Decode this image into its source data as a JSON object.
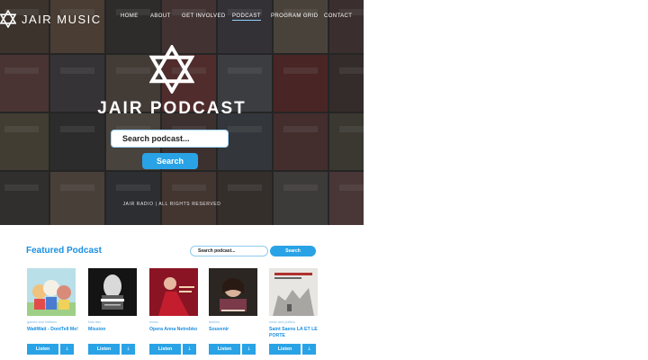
{
  "brand": {
    "name": "JAIR MUSIC",
    "logo_icon": "star-of-david-icon"
  },
  "nav": [
    "HOME",
    "ABOUT",
    "GET INVOLVED",
    "PODCAST",
    "PROGRAM GRID",
    "CONTACT"
  ],
  "nav_active": "PODCAST",
  "hero": {
    "title": "JAIR PODCAST",
    "search_placeholder": "Search podcast...",
    "search_button": "Search",
    "footer": "JAIR RADIO | ALL RIGHTS RESERVED"
  },
  "featured": {
    "title": "Featured Podcast",
    "search_placeholder": "Search podcast...",
    "search_button": "Search",
    "listen_label": "Listen",
    "download_icon": "download-arrow-icon",
    "items": [
      {
        "category": "games and hobbies",
        "title": "WaitWait - DontTell Me!"
      },
      {
        "category": "kids fam",
        "title": "Mission"
      },
      {
        "category": "music",
        "title": "Opera Anna Netrebko"
      },
      {
        "category": "fashion",
        "title": "Souvenir"
      },
      {
        "category": "news and politics",
        "title": "Saint Saens LA ET LE PORTE"
      }
    ]
  },
  "colors": {
    "accent": "#29a3e6",
    "heading": "#1a8fe0",
    "hero_overlay": "#2a2a2a"
  }
}
